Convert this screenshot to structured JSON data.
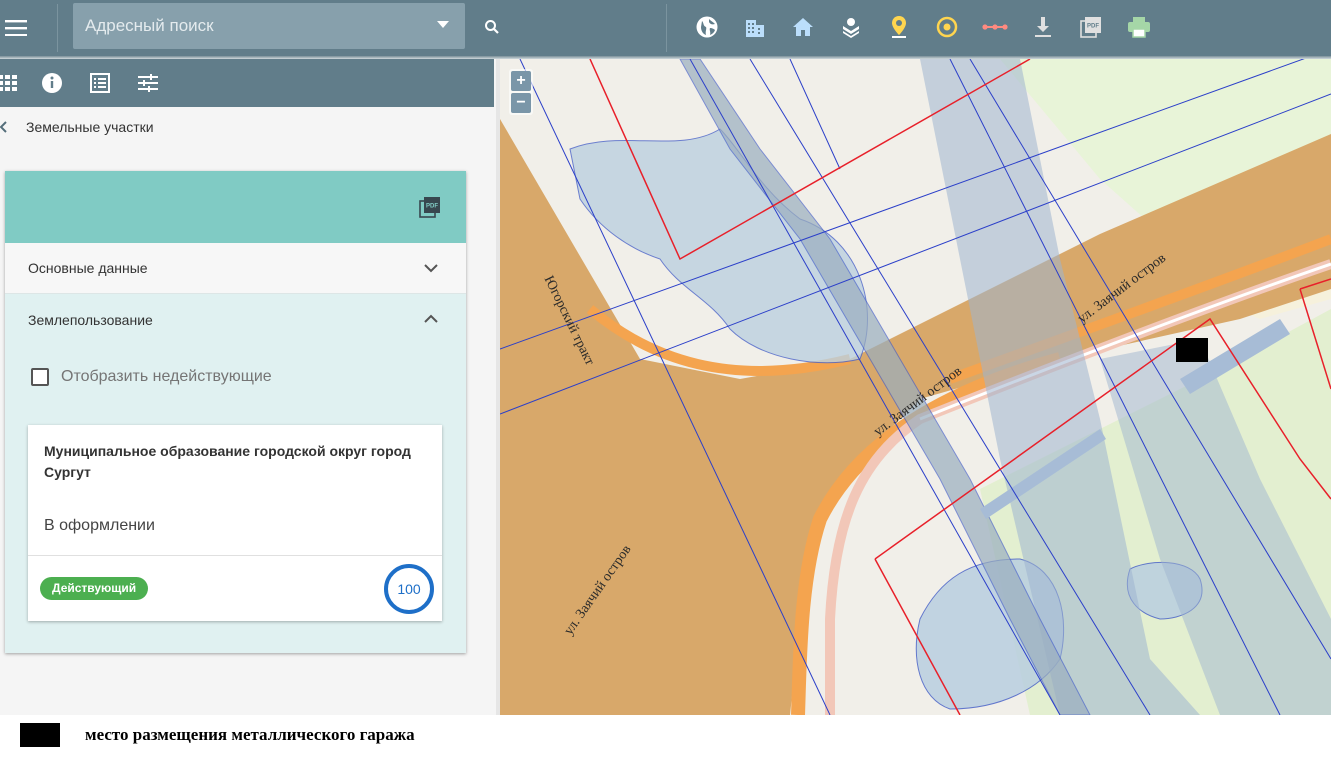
{
  "header": {
    "search": {
      "placeholder": "Адресный поиск",
      "value": ""
    },
    "tools": [
      "globe-icon",
      "buildings-icon",
      "home-icon",
      "layers-icon",
      "location-pin-icon",
      "target-icon",
      "measure-icon",
      "download-icon",
      "pdf-icon",
      "printer-icon"
    ]
  },
  "panel": {
    "tools": [
      "grid-icon",
      "info-icon",
      "list-icon",
      "sliders-icon"
    ],
    "back_label": "Земельные участки",
    "sections": {
      "main": "Основные данные",
      "land_use": "Землепользование"
    },
    "show_inactive_label": "Отобразить недействующие",
    "entry": {
      "owner": "Муниципальное образование городской округ город Сургут",
      "status": "В оформлении",
      "badge": "Действующий",
      "share": "100"
    }
  },
  "map": {
    "zoom_in": "+",
    "zoom_out": "−",
    "labels": {
      "yugorsky": "Югорский тракт",
      "zayachiy_upper": "ул. Заячий остров",
      "zayachiy_center": "ул. Заячий остров",
      "zayachiy_lower": "ул. Заячий остров"
    }
  },
  "legend": {
    "text": "место размещения металлического гаража"
  },
  "colors": {
    "header": "#617d8a",
    "card_header": "#80cbc4",
    "badge": "#4caf50",
    "share_ring": "#1e6fc8",
    "parcel_outline": "#e8202a",
    "cadastral_lines": "#2b3fc9"
  }
}
